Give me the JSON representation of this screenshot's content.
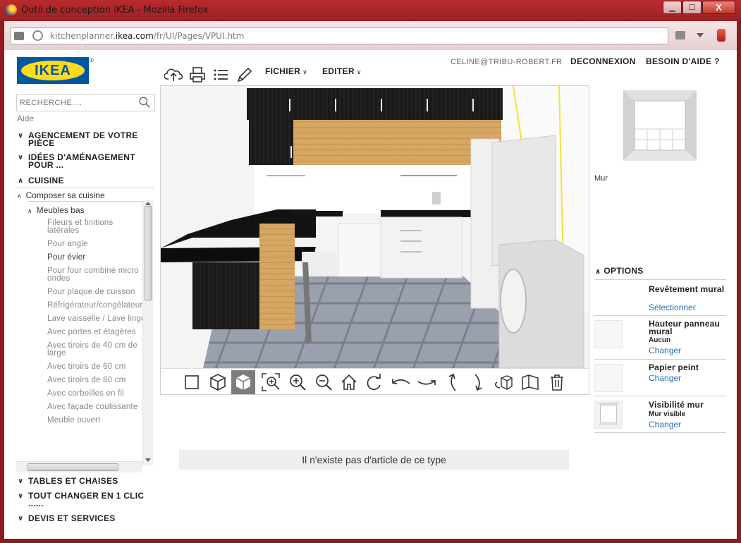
{
  "window": {
    "title": "Outil de conception IKEA - Mozilla Firefox",
    "min_label": "▁",
    "max_label": "☐",
    "close_label": "X"
  },
  "browser": {
    "url_prefix": "kitchenplanner.",
    "url_domain": "ikea.com",
    "url_suffix": "/fr/UI/Pages/VPUI.htm"
  },
  "logo": {
    "text": "IKEA",
    "registered": "®"
  },
  "search": {
    "placeholder": "RECHERCHE...."
  },
  "sidebar": {
    "aide": "Aide",
    "sections_top": [
      {
        "label": "AGENCEMENT DE VOTRE PIÈCE",
        "chevron": "∨"
      },
      {
        "label": "IDÉES D'AMÉNAGEMENT POUR ...",
        "chevron": "∨"
      },
      {
        "label": "CUISINE",
        "chevron": "∧"
      }
    ],
    "composer": "Composer sa cuisine",
    "meubles_bas": "Meubles bas",
    "items": [
      "Fileurs et finitions latérales",
      "Pour angle",
      "Pour évier",
      "Pour four combiné micro ondes",
      "Pour plaque de cuisson",
      "Réfrigérateur/congélateur",
      "Lave vaisselle / Lave linge",
      "Avec portes et étagères",
      "Avec tiroirs de 40 cm de large",
      "Avec tiroirs de 60 cm",
      "Avec tiroirs de 80 cm",
      "Avec corbeilles en fil",
      "Avec façade coulissante",
      "Meuble ouvert"
    ],
    "sections_bottom": [
      {
        "label": "TABLES ET CHAISES",
        "chevron": "∨"
      },
      {
        "label": "TOUT CHANGER EN 1 CLIC ......",
        "chevron": "∨"
      },
      {
        "label": "DEVIS ET SERVICES",
        "chevron": "∨"
      }
    ]
  },
  "header": {
    "email": "CELINE@TRIBU-ROBERT.FR",
    "logout": "DECONNEXION",
    "help": "BESOIN D'AIDE ?"
  },
  "toolbar": {
    "fichier": "FICHIER",
    "editer": "EDITER",
    "icons": [
      "cloud-upload-icon",
      "print-icon",
      "list-icon",
      "pencil-icon"
    ]
  },
  "view_tools": [
    "2d-view-icon",
    "3d-view-icon",
    "3d-view-solid-icon",
    "zoom-selection-icon",
    "zoom-in-icon",
    "zoom-out-icon",
    "home-icon",
    "rotate-right-icon",
    "rotate-left-icon",
    "rotate-clockwise-icon",
    "tilt-up-icon",
    "tilt-down-icon",
    "rotate-object-icon",
    "walls-icon",
    "trash-icon"
  ],
  "no_article": "Il n'existe pas d'article de ce type",
  "right_panel": {
    "wall_label": "Mur",
    "options_label": "OPTIONS",
    "options_chevron": "∧",
    "options": [
      {
        "title": "Revêtement mural",
        "sub": "",
        "link": "Sélectionner"
      },
      {
        "title": "Hauteur panneau mural",
        "sub": "Aucun",
        "link": "Changer"
      },
      {
        "title": "Papier peint",
        "sub": "",
        "link": "Changer"
      },
      {
        "title": "Visibilité mur",
        "sub": "Mur visible",
        "link": "Changer"
      }
    ]
  },
  "colors": {
    "titlebar": "#b92a2e",
    "ikea_blue": "#0058a3",
    "ikea_yellow": "#ffda1a",
    "link": "#2a6fb8"
  }
}
